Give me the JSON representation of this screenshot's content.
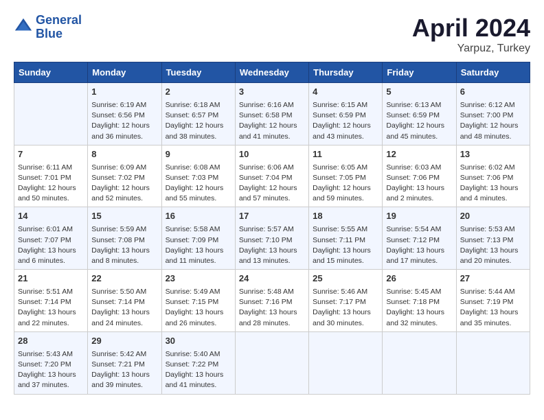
{
  "header": {
    "logo_line1": "General",
    "logo_line2": "Blue",
    "month_year": "April 2024",
    "location": "Yarpuz, Turkey"
  },
  "days_of_week": [
    "Sunday",
    "Monday",
    "Tuesday",
    "Wednesday",
    "Thursday",
    "Friday",
    "Saturday"
  ],
  "weeks": [
    [
      {
        "day": "",
        "sunrise": "",
        "sunset": "",
        "daylight": ""
      },
      {
        "day": "1",
        "sunrise": "Sunrise: 6:19 AM",
        "sunset": "Sunset: 6:56 PM",
        "daylight": "Daylight: 12 hours and 36 minutes."
      },
      {
        "day": "2",
        "sunrise": "Sunrise: 6:18 AM",
        "sunset": "Sunset: 6:57 PM",
        "daylight": "Daylight: 12 hours and 38 minutes."
      },
      {
        "day": "3",
        "sunrise": "Sunrise: 6:16 AM",
        "sunset": "Sunset: 6:58 PM",
        "daylight": "Daylight: 12 hours and 41 minutes."
      },
      {
        "day": "4",
        "sunrise": "Sunrise: 6:15 AM",
        "sunset": "Sunset: 6:59 PM",
        "daylight": "Daylight: 12 hours and 43 minutes."
      },
      {
        "day": "5",
        "sunrise": "Sunrise: 6:13 AM",
        "sunset": "Sunset: 6:59 PM",
        "daylight": "Daylight: 12 hours and 45 minutes."
      },
      {
        "day": "6",
        "sunrise": "Sunrise: 6:12 AM",
        "sunset": "Sunset: 7:00 PM",
        "daylight": "Daylight: 12 hours and 48 minutes."
      }
    ],
    [
      {
        "day": "7",
        "sunrise": "Sunrise: 6:11 AM",
        "sunset": "Sunset: 7:01 PM",
        "daylight": "Daylight: 12 hours and 50 minutes."
      },
      {
        "day": "8",
        "sunrise": "Sunrise: 6:09 AM",
        "sunset": "Sunset: 7:02 PM",
        "daylight": "Daylight: 12 hours and 52 minutes."
      },
      {
        "day": "9",
        "sunrise": "Sunrise: 6:08 AM",
        "sunset": "Sunset: 7:03 PM",
        "daylight": "Daylight: 12 hours and 55 minutes."
      },
      {
        "day": "10",
        "sunrise": "Sunrise: 6:06 AM",
        "sunset": "Sunset: 7:04 PM",
        "daylight": "Daylight: 12 hours and 57 minutes."
      },
      {
        "day": "11",
        "sunrise": "Sunrise: 6:05 AM",
        "sunset": "Sunset: 7:05 PM",
        "daylight": "Daylight: 12 hours and 59 minutes."
      },
      {
        "day": "12",
        "sunrise": "Sunrise: 6:03 AM",
        "sunset": "Sunset: 7:06 PM",
        "daylight": "Daylight: 13 hours and 2 minutes."
      },
      {
        "day": "13",
        "sunrise": "Sunrise: 6:02 AM",
        "sunset": "Sunset: 7:06 PM",
        "daylight": "Daylight: 13 hours and 4 minutes."
      }
    ],
    [
      {
        "day": "14",
        "sunrise": "Sunrise: 6:01 AM",
        "sunset": "Sunset: 7:07 PM",
        "daylight": "Daylight: 13 hours and 6 minutes."
      },
      {
        "day": "15",
        "sunrise": "Sunrise: 5:59 AM",
        "sunset": "Sunset: 7:08 PM",
        "daylight": "Daylight: 13 hours and 8 minutes."
      },
      {
        "day": "16",
        "sunrise": "Sunrise: 5:58 AM",
        "sunset": "Sunset: 7:09 PM",
        "daylight": "Daylight: 13 hours and 11 minutes."
      },
      {
        "day": "17",
        "sunrise": "Sunrise: 5:57 AM",
        "sunset": "Sunset: 7:10 PM",
        "daylight": "Daylight: 13 hours and 13 minutes."
      },
      {
        "day": "18",
        "sunrise": "Sunrise: 5:55 AM",
        "sunset": "Sunset: 7:11 PM",
        "daylight": "Daylight: 13 hours and 15 minutes."
      },
      {
        "day": "19",
        "sunrise": "Sunrise: 5:54 AM",
        "sunset": "Sunset: 7:12 PM",
        "daylight": "Daylight: 13 hours and 17 minutes."
      },
      {
        "day": "20",
        "sunrise": "Sunrise: 5:53 AM",
        "sunset": "Sunset: 7:13 PM",
        "daylight": "Daylight: 13 hours and 20 minutes."
      }
    ],
    [
      {
        "day": "21",
        "sunrise": "Sunrise: 5:51 AM",
        "sunset": "Sunset: 7:14 PM",
        "daylight": "Daylight: 13 hours and 22 minutes."
      },
      {
        "day": "22",
        "sunrise": "Sunrise: 5:50 AM",
        "sunset": "Sunset: 7:14 PM",
        "daylight": "Daylight: 13 hours and 24 minutes."
      },
      {
        "day": "23",
        "sunrise": "Sunrise: 5:49 AM",
        "sunset": "Sunset: 7:15 PM",
        "daylight": "Daylight: 13 hours and 26 minutes."
      },
      {
        "day": "24",
        "sunrise": "Sunrise: 5:48 AM",
        "sunset": "Sunset: 7:16 PM",
        "daylight": "Daylight: 13 hours and 28 minutes."
      },
      {
        "day": "25",
        "sunrise": "Sunrise: 5:46 AM",
        "sunset": "Sunset: 7:17 PM",
        "daylight": "Daylight: 13 hours and 30 minutes."
      },
      {
        "day": "26",
        "sunrise": "Sunrise: 5:45 AM",
        "sunset": "Sunset: 7:18 PM",
        "daylight": "Daylight: 13 hours and 32 minutes."
      },
      {
        "day": "27",
        "sunrise": "Sunrise: 5:44 AM",
        "sunset": "Sunset: 7:19 PM",
        "daylight": "Daylight: 13 hours and 35 minutes."
      }
    ],
    [
      {
        "day": "28",
        "sunrise": "Sunrise: 5:43 AM",
        "sunset": "Sunset: 7:20 PM",
        "daylight": "Daylight: 13 hours and 37 minutes."
      },
      {
        "day": "29",
        "sunrise": "Sunrise: 5:42 AM",
        "sunset": "Sunset: 7:21 PM",
        "daylight": "Daylight: 13 hours and 39 minutes."
      },
      {
        "day": "30",
        "sunrise": "Sunrise: 5:40 AM",
        "sunset": "Sunset: 7:22 PM",
        "daylight": "Daylight: 13 hours and 41 minutes."
      },
      {
        "day": "",
        "sunrise": "",
        "sunset": "",
        "daylight": ""
      },
      {
        "day": "",
        "sunrise": "",
        "sunset": "",
        "daylight": ""
      },
      {
        "day": "",
        "sunrise": "",
        "sunset": "",
        "daylight": ""
      },
      {
        "day": "",
        "sunrise": "",
        "sunset": "",
        "daylight": ""
      }
    ]
  ]
}
